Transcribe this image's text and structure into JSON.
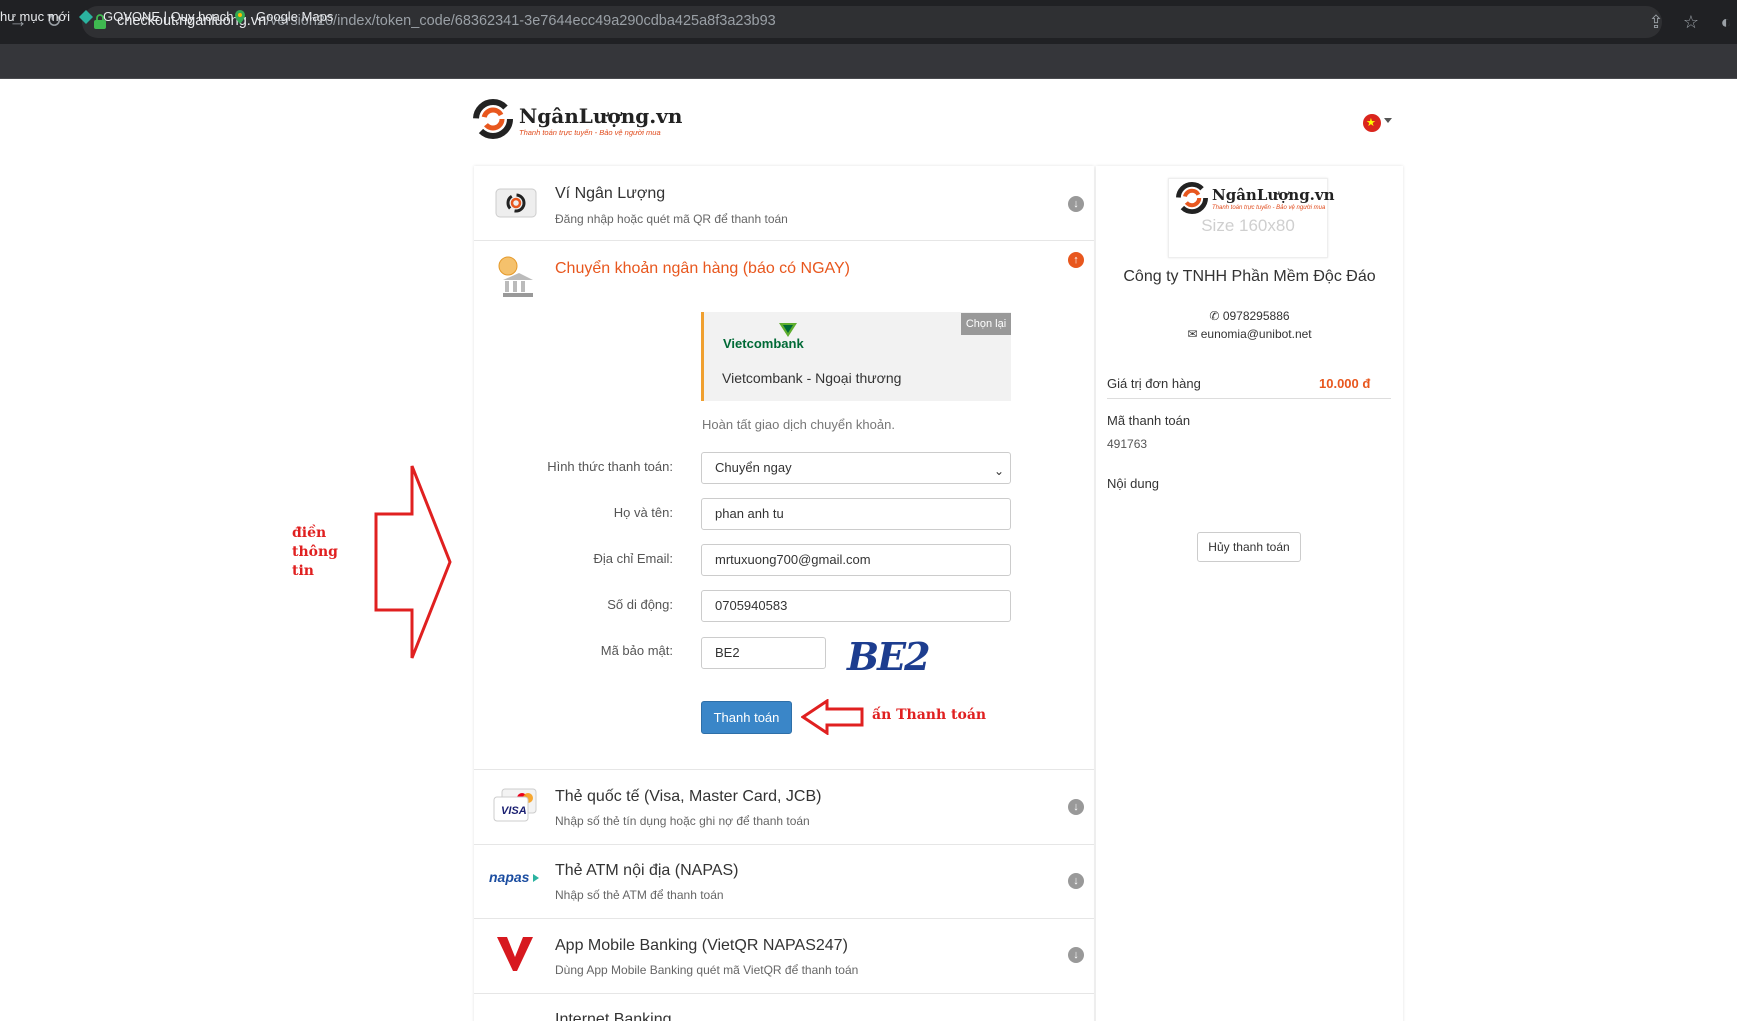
{
  "browser": {
    "url_host": "checkout.nganluong.vn",
    "url_path": "/version20/index/token_code/68362341-3e7644ecc49a290cdba425a8f3a23b93",
    "bookmarks": [
      "hư mục mới",
      "GOVONE | Quy hoạch",
      "Google Maps"
    ]
  },
  "header": {
    "logo_text": "NgânLượng.vn",
    "logo_tagline": "Thanh toán trực tuyến - Bảo vệ người mua"
  },
  "methods": [
    {
      "title": "Ví Ngân Lượng",
      "desc": "Đăng nhập hoặc quét mã QR để thanh toán"
    },
    {
      "title": "Chuyển khoản ngân hàng (báo có NGAY)",
      "desc": ""
    },
    {
      "title": "Thẻ quốc tế (Visa, Master Card, JCB)",
      "desc": "Nhập số thẻ tín dụng hoặc ghi nợ để thanh toán"
    },
    {
      "title": "Thẻ ATM nội địa (NAPAS)",
      "desc": "Nhập số thẻ ATM để thanh toán"
    },
    {
      "title": "App Mobile Banking (VietQR NAPAS247)",
      "desc": "Dùng App Mobile Banking quét mã VietQR để thanh toán"
    },
    {
      "title": "Internet Banking",
      "desc": ""
    }
  ],
  "bank": {
    "chon_lai": "Chọn lại",
    "logo_text": "Vietcombank",
    "name": "Vietcombank - Ngoại thương",
    "note": "Hoàn tất giao dịch chuyển khoản."
  },
  "form": {
    "payment_type_label": "Hình thức thanh toán:",
    "payment_type_value": "Chuyển ngay",
    "name_label": "Họ và tên:",
    "name_value": "phan anh tu",
    "email_label": "Địa chỉ Email:",
    "email_value": "mrtuxuong700@gmail.com",
    "phone_label": "Số di động:",
    "phone_value": "0705940583",
    "captcha_label": "Mã bảo mật:",
    "captcha_value": "BE2",
    "captcha_image_text": "BE2",
    "submit_label": "Thanh toán"
  },
  "annotations": {
    "left": "điền thông tin",
    "right": "ấn Thanh toán"
  },
  "merchant": {
    "logo_text": "NgânLượng.vn",
    "logo_tagline": "Thanh toán trực tuyến - Bảo vệ người mua",
    "logo_size_hint": "Size 160x80",
    "company": "Công ty TNHH Phần Mềm Độc Đáo",
    "phone": "0978295886",
    "email": "eunomia@unibot.net"
  },
  "order": {
    "value_label": "Giá trị đơn hàng",
    "value": "10.000 đ",
    "code_label": "Mã thanh toán",
    "code": "491763",
    "content_label": "Nội dung",
    "cancel_label": "Hủy thanh toán"
  },
  "colors": {
    "accent": "#e8571e",
    "primary": "#3a86c8",
    "annotation": "#e02020"
  }
}
